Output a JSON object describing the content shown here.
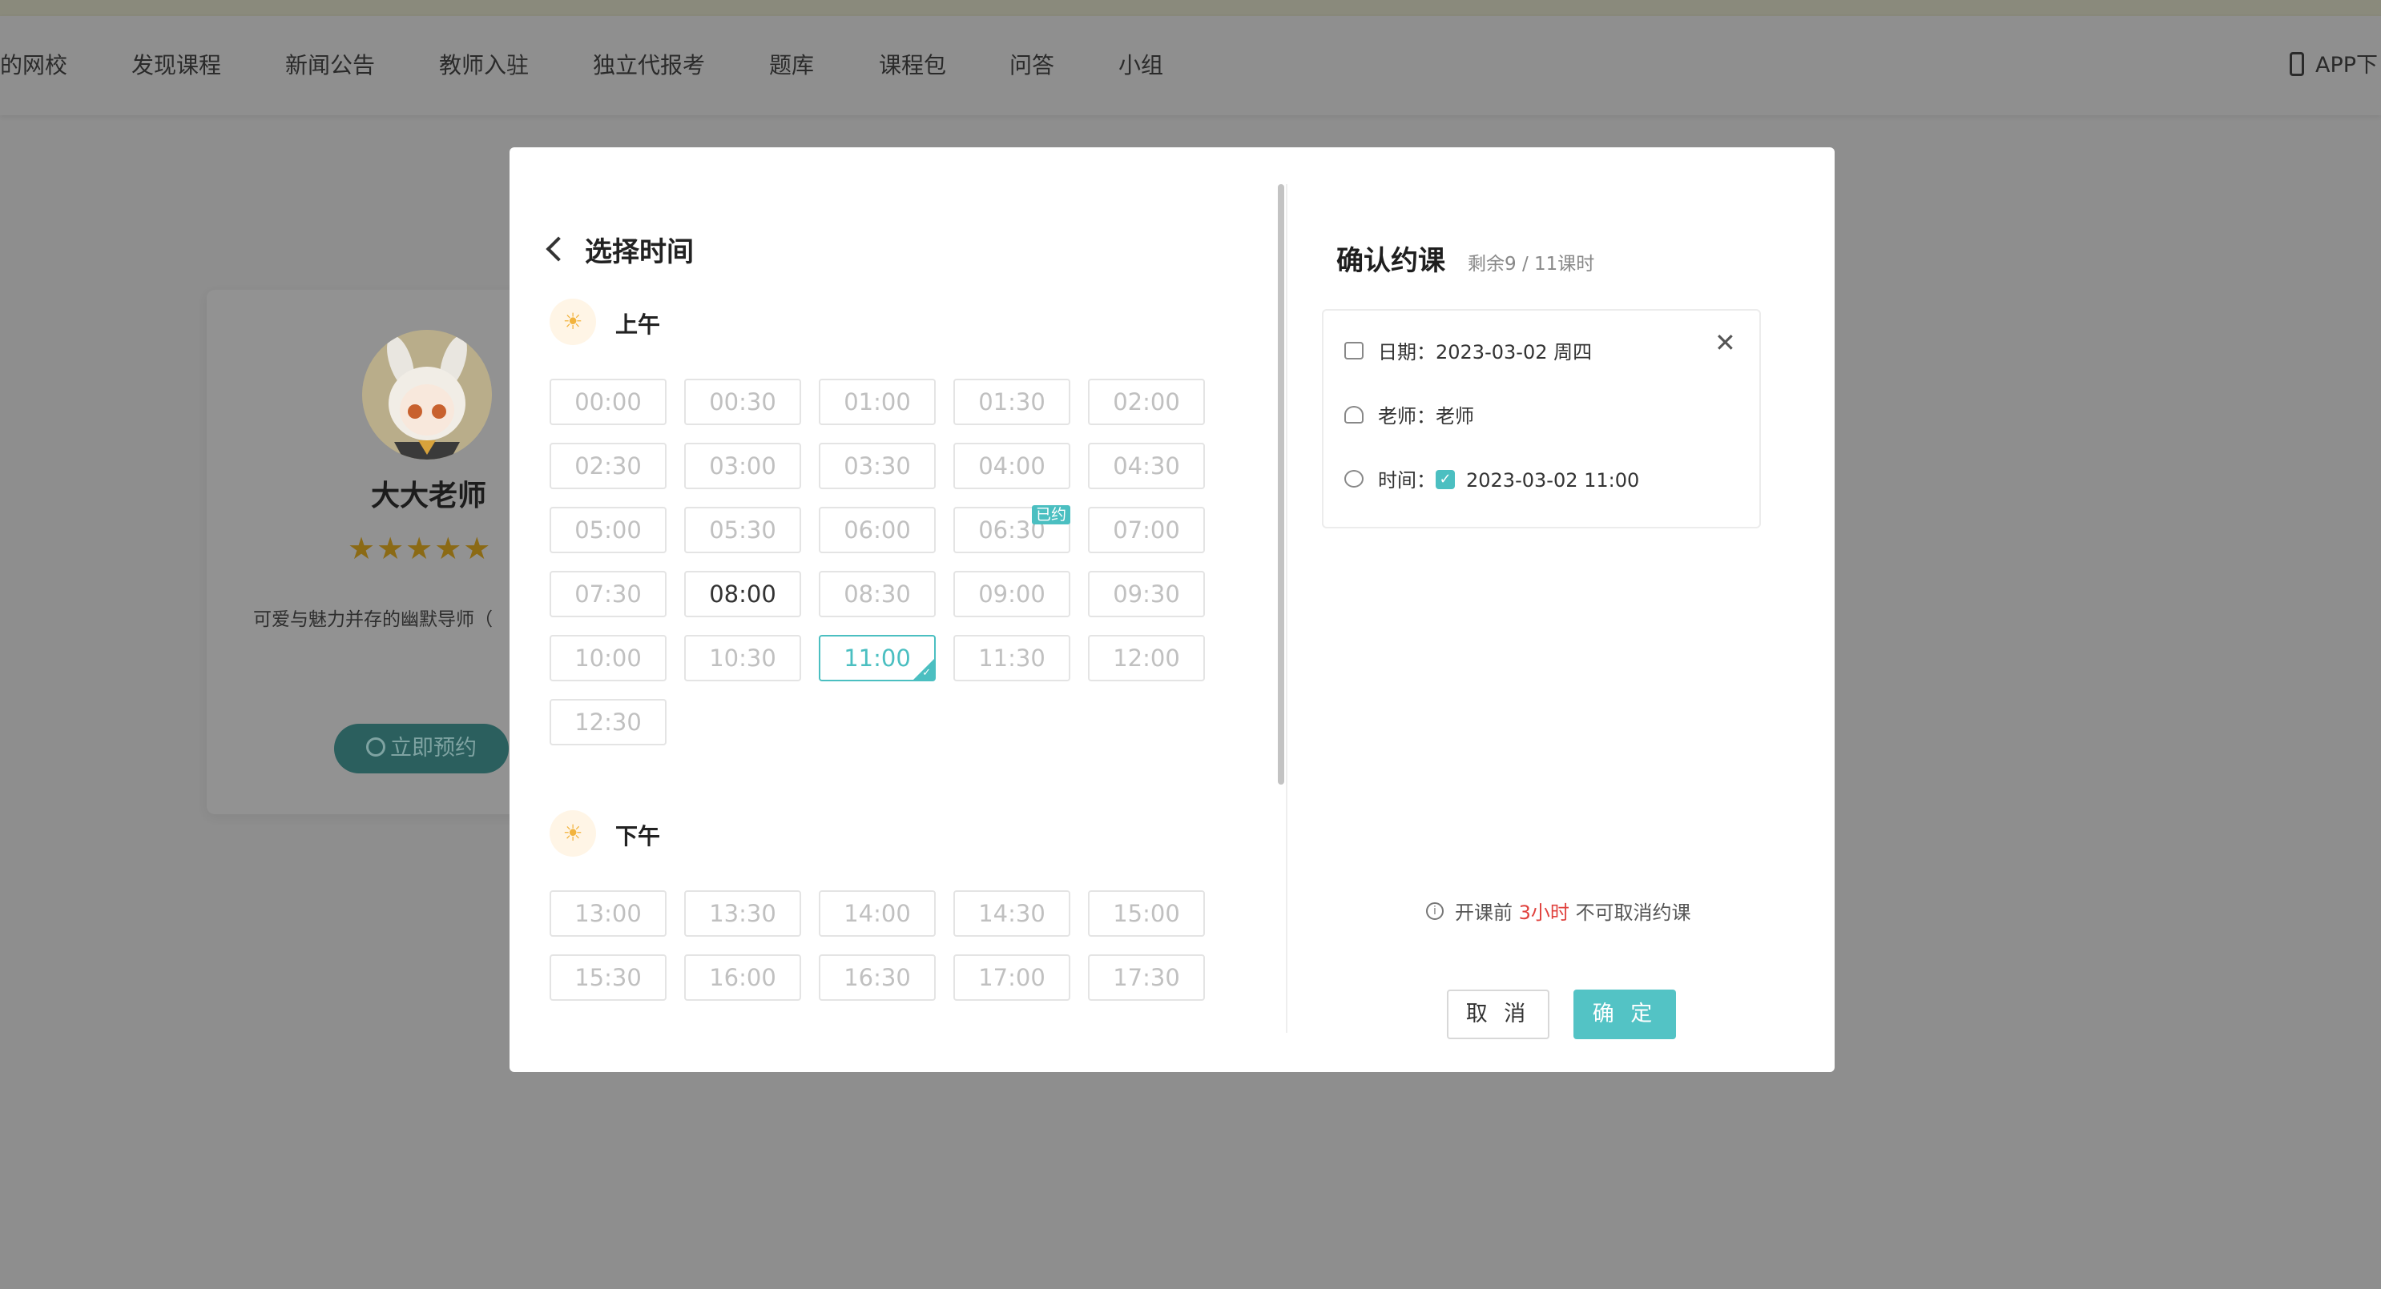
{
  "nav": {
    "items": [
      "的网校",
      "发现课程",
      "新闻公告",
      "教师入驻",
      "独立代报考",
      "题库",
      "课程包",
      "问答",
      "小组"
    ],
    "app_download": "APP下"
  },
  "teacher_card": {
    "name": "大大老师",
    "rating_stars": 5,
    "stars_text": "★★★★★",
    "description": "可爱与魅力并存的幽默导师（",
    "book_button": "立即预约"
  },
  "modal": {
    "back_title": "选择时间",
    "morning_label": "上午",
    "afternoon_label": "下午",
    "booked_badge": "已约",
    "morning_slots": [
      {
        "time": "00:00",
        "state": "disabled"
      },
      {
        "time": "00:30",
        "state": "disabled"
      },
      {
        "time": "01:00",
        "state": "disabled"
      },
      {
        "time": "01:30",
        "state": "disabled"
      },
      {
        "time": "02:00",
        "state": "disabled"
      },
      {
        "time": "02:30",
        "state": "disabled"
      },
      {
        "time": "03:00",
        "state": "disabled"
      },
      {
        "time": "03:30",
        "state": "disabled"
      },
      {
        "time": "04:00",
        "state": "disabled"
      },
      {
        "time": "04:30",
        "state": "disabled"
      },
      {
        "time": "05:00",
        "state": "disabled"
      },
      {
        "time": "05:30",
        "state": "disabled"
      },
      {
        "time": "06:00",
        "state": "disabled"
      },
      {
        "time": "06:30",
        "state": "booked"
      },
      {
        "time": "07:00",
        "state": "disabled"
      },
      {
        "time": "07:30",
        "state": "disabled"
      },
      {
        "time": "08:00",
        "state": "available"
      },
      {
        "time": "08:30",
        "state": "disabled"
      },
      {
        "time": "09:00",
        "state": "disabled"
      },
      {
        "time": "09:30",
        "state": "disabled"
      },
      {
        "time": "10:00",
        "state": "disabled"
      },
      {
        "time": "10:30",
        "state": "disabled"
      },
      {
        "time": "11:00",
        "state": "selected"
      },
      {
        "time": "11:30",
        "state": "disabled"
      },
      {
        "time": "12:00",
        "state": "disabled"
      },
      {
        "time": "12:30",
        "state": "disabled"
      }
    ],
    "afternoon_slots": [
      {
        "time": "13:00",
        "state": "disabled"
      },
      {
        "time": "13:30",
        "state": "disabled"
      },
      {
        "time": "14:00",
        "state": "disabled"
      },
      {
        "time": "14:30",
        "state": "disabled"
      },
      {
        "time": "15:00",
        "state": "disabled"
      },
      {
        "time": "15:30",
        "state": "disabled"
      },
      {
        "time": "16:00",
        "state": "disabled"
      },
      {
        "time": "16:30",
        "state": "disabled"
      },
      {
        "time": "17:00",
        "state": "disabled"
      },
      {
        "time": "17:30",
        "state": "disabled"
      }
    ],
    "confirm": {
      "title": "确认约课",
      "remaining": "剩余9 / 11课时",
      "date_label": "日期：",
      "date_value": "2023-03-02 周四",
      "teacher_label": "老师：",
      "teacher_value": "老师",
      "time_label": "时间：",
      "time_value": "2023-03-02 11:00",
      "notice_prefix": "开课前",
      "notice_highlight": "3小时",
      "notice_suffix": "不可取消约课",
      "cancel_button": "取 消",
      "ok_button": "确 定"
    }
  },
  "colors": {
    "accent": "#53c3c5",
    "highlight_red": "#e0423e",
    "overlay": "#8e8e8e"
  }
}
